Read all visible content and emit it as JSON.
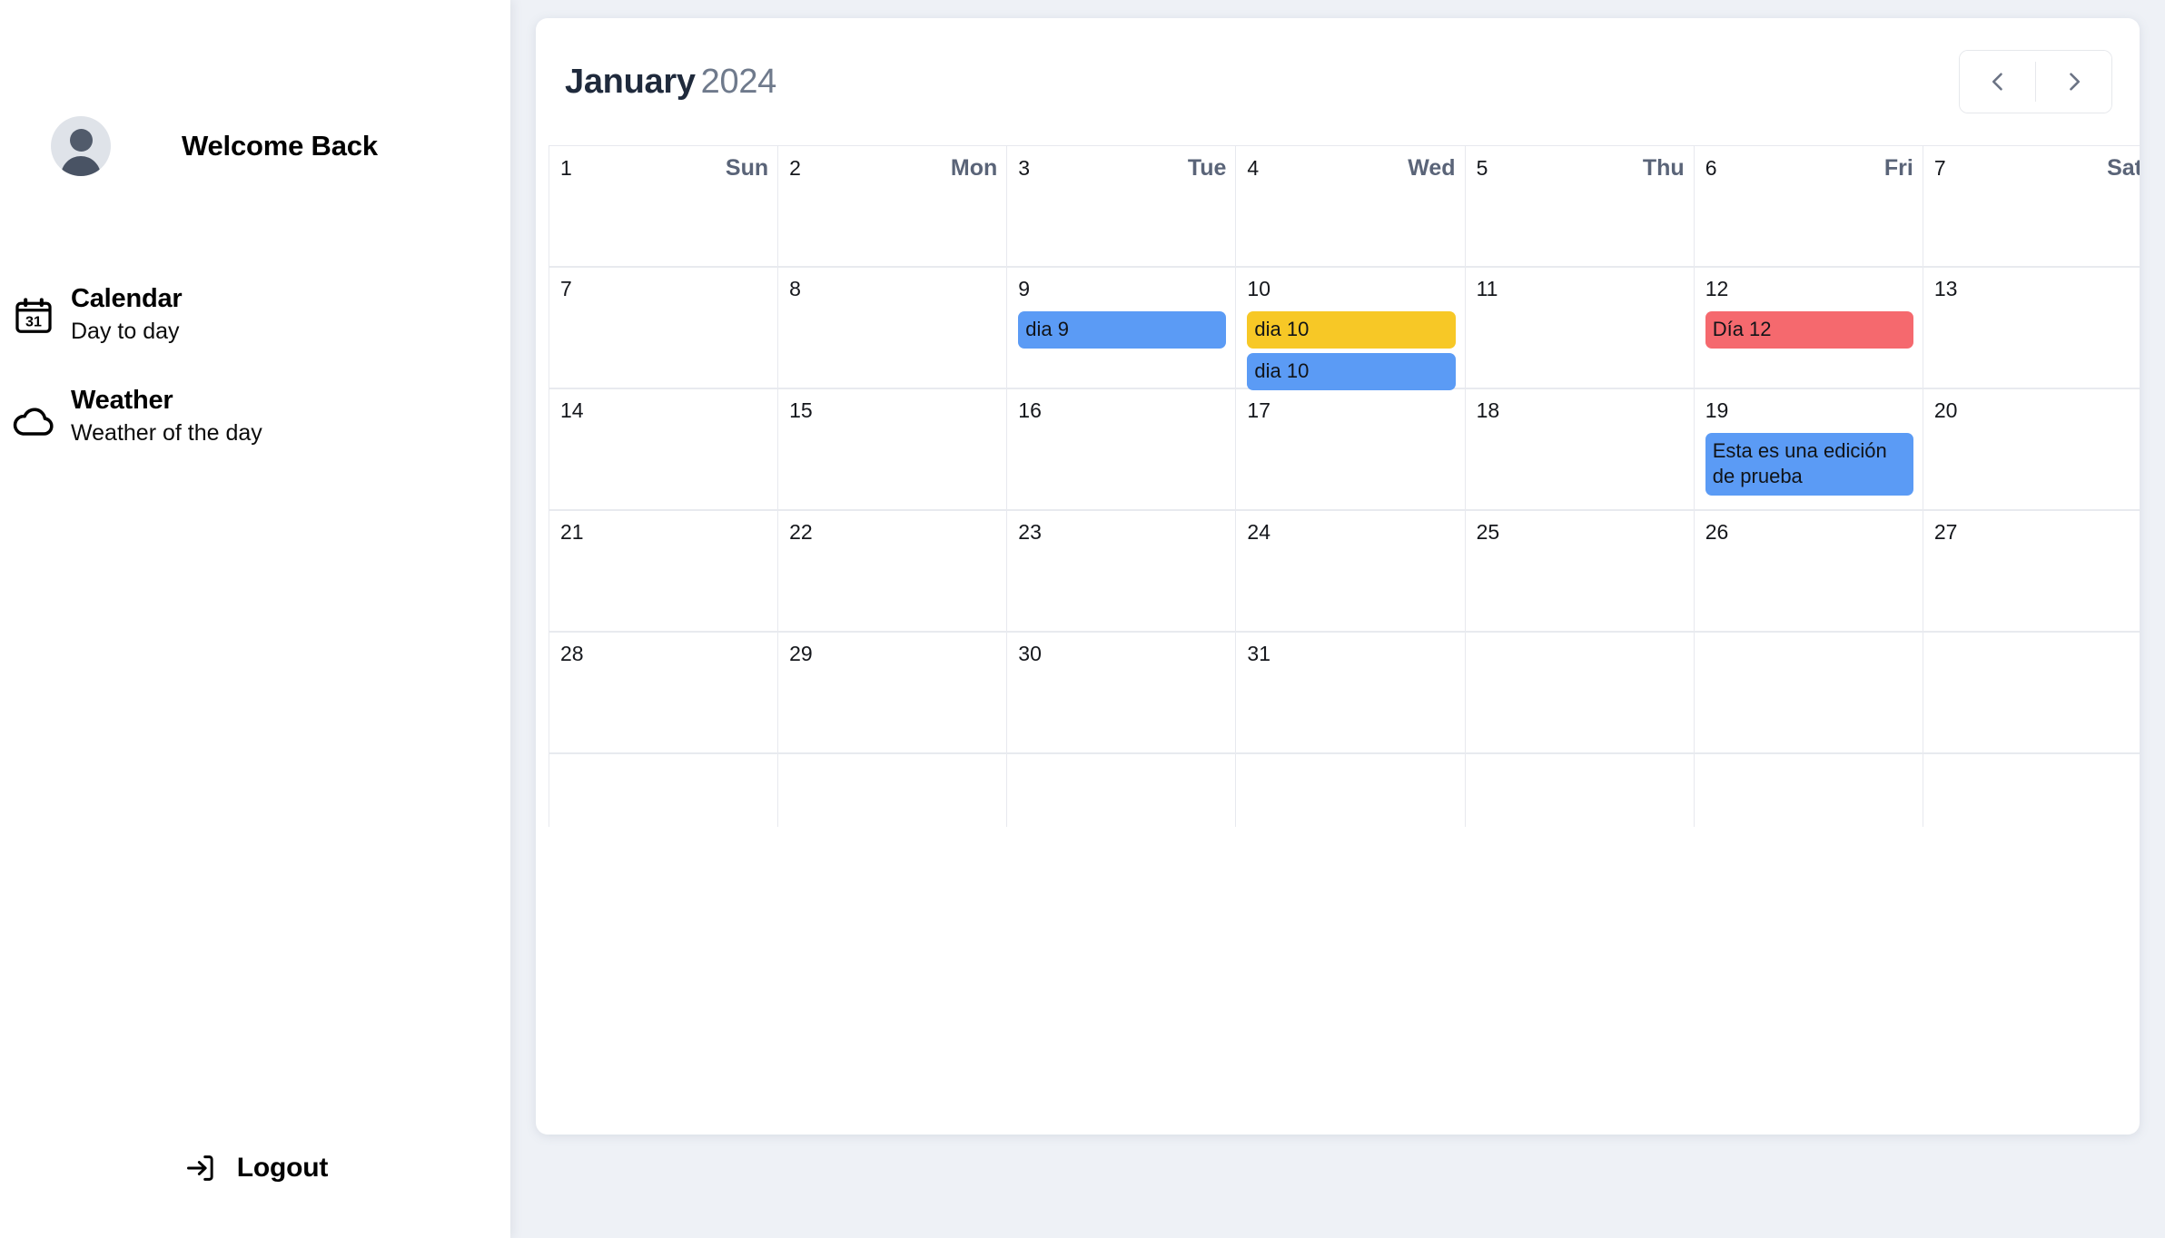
{
  "sidebar": {
    "welcome": "Welcome Back",
    "avatar_icon": "user-avatar-icon",
    "items": [
      {
        "icon": "calendar-31-icon",
        "title": "Calendar",
        "subtitle": "Day to day"
      },
      {
        "icon": "cloud-weather-icon",
        "title": "Weather",
        "subtitle": "Weather of the day"
      }
    ],
    "logout": {
      "label": "Logout",
      "icon": "logout-arrow-icon"
    }
  },
  "calendar": {
    "month": "January",
    "year": "2024",
    "prev_icon": "chevron-left-icon",
    "next_icon": "chevron-right-icon",
    "weekdays": [
      "Sun",
      "Mon",
      "Tue",
      "Wed",
      "Thu",
      "Fri",
      "Sat"
    ],
    "colors": {
      "event_blue": "#5b9bf5",
      "event_yellow": "#f7c826",
      "event_red": "#f5696e",
      "page_background": "#eef1f6",
      "card_background": "#ffffff",
      "grid_line": "#e7e9ee",
      "title_dark": "#1f2a3c",
      "year_gray": "#6f7a8c",
      "weekday_gray": "#5a6478"
    },
    "weeks": [
      [
        {
          "day": "1",
          "dow": "Sun",
          "events": []
        },
        {
          "day": "2",
          "dow": "Mon",
          "events": []
        },
        {
          "day": "3",
          "dow": "Tue",
          "events": []
        },
        {
          "day": "4",
          "dow": "Wed",
          "events": []
        },
        {
          "day": "5",
          "dow": "Thu",
          "events": []
        },
        {
          "day": "6",
          "dow": "Fri",
          "events": []
        },
        {
          "day": "7",
          "dow": "Sat",
          "events": []
        }
      ],
      [
        {
          "day": "7",
          "dow": "",
          "events": []
        },
        {
          "day": "8",
          "dow": "",
          "events": []
        },
        {
          "day": "9",
          "dow": "",
          "events": [
            {
              "title": "dia 9",
              "color": "blue"
            }
          ]
        },
        {
          "day": "10",
          "dow": "",
          "events": [
            {
              "title": "dia 10",
              "color": "yellow"
            },
            {
              "title": "dia 10",
              "color": "blue"
            }
          ]
        },
        {
          "day": "11",
          "dow": "",
          "events": []
        },
        {
          "day": "12",
          "dow": "",
          "events": [
            {
              "title": "Día 12",
              "color": "red"
            }
          ]
        },
        {
          "day": "13",
          "dow": "",
          "events": []
        }
      ],
      [
        {
          "day": "14",
          "dow": "",
          "events": []
        },
        {
          "day": "15",
          "dow": "",
          "events": []
        },
        {
          "day": "16",
          "dow": "",
          "events": []
        },
        {
          "day": "17",
          "dow": "",
          "events": []
        },
        {
          "day": "18",
          "dow": "",
          "events": []
        },
        {
          "day": "19",
          "dow": "",
          "events": [
            {
              "title": "Esta es una edición de prueba",
              "color": "blue"
            }
          ]
        },
        {
          "day": "20",
          "dow": "",
          "events": []
        }
      ],
      [
        {
          "day": "21",
          "dow": "",
          "events": []
        },
        {
          "day": "22",
          "dow": "",
          "events": []
        },
        {
          "day": "23",
          "dow": "",
          "events": []
        },
        {
          "day": "24",
          "dow": "",
          "events": []
        },
        {
          "day": "25",
          "dow": "",
          "events": []
        },
        {
          "day": "26",
          "dow": "",
          "events": []
        },
        {
          "day": "27",
          "dow": "",
          "events": []
        }
      ],
      [
        {
          "day": "28",
          "dow": "",
          "events": []
        },
        {
          "day": "29",
          "dow": "",
          "events": []
        },
        {
          "day": "30",
          "dow": "",
          "events": []
        },
        {
          "day": "31",
          "dow": "",
          "events": []
        },
        {
          "day": "",
          "dow": "",
          "events": []
        },
        {
          "day": "",
          "dow": "",
          "events": []
        },
        {
          "day": "",
          "dow": "",
          "events": []
        }
      ],
      [
        {
          "day": "",
          "dow": "",
          "events": []
        },
        {
          "day": "",
          "dow": "",
          "events": []
        },
        {
          "day": "",
          "dow": "",
          "events": []
        },
        {
          "day": "",
          "dow": "",
          "events": []
        },
        {
          "day": "",
          "dow": "",
          "events": []
        },
        {
          "day": "",
          "dow": "",
          "events": []
        },
        {
          "day": "",
          "dow": "",
          "events": []
        }
      ]
    ]
  }
}
